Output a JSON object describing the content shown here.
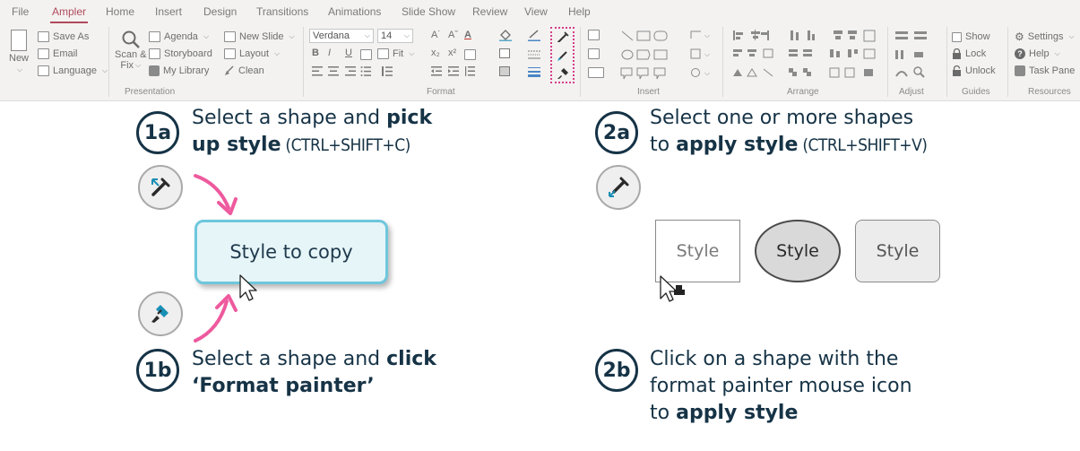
{
  "menu": [
    "File",
    "Ampler",
    "Home",
    "Insert",
    "Design",
    "Transitions",
    "Animations",
    "Slide Show",
    "Review",
    "View",
    "Help"
  ],
  "menu_active": "Ampler",
  "ribbon": {
    "new_label": "New",
    "save_as": "Save As",
    "email": "Email",
    "language": "Language",
    "scan_fix": "Scan &",
    "scan_fix_2": "Fix",
    "agenda": "Agenda",
    "storyboard": "Storyboard",
    "my_library": "My Library",
    "new_slide": "New Slide",
    "layout": "Layout",
    "clean": "Clean",
    "font_name": "Verdana",
    "font_size": "14",
    "fit": "Fit",
    "show": "Show",
    "lock": "Lock",
    "unlock": "Unlock",
    "settings": "Settings",
    "help": "Help",
    "task_pane": "Task Pane",
    "groups": {
      "presentation": "Presentation",
      "format": "Format",
      "insert": "Insert",
      "arrange": "Arrange",
      "adjust": "Adjust",
      "guides": "Guides",
      "resources": "Resources"
    }
  },
  "steps": {
    "s1a": {
      "badge": "1a",
      "line1": "Select a shape and ",
      "line1_bold": "pick",
      "line2_bold": "up style",
      "line2_shortcut": " (CTRL+SHIFT+C)"
    },
    "s1b": {
      "badge": "1b",
      "line1": "Select a shape and ",
      "line1_bold": "click",
      "line2_bold": "‘Format painter’"
    },
    "s2a": {
      "badge": "2a",
      "line1": "Select one or more shapes",
      "line2": "to ",
      "line2_bold": "apply style",
      "line2_shortcut": " (CTRL+SHIFT+V)"
    },
    "s2b": {
      "badge": "2b",
      "line1": "Click on a shape with the",
      "line2": "format painter mouse icon",
      "line3": "to ",
      "line3_bold": "apply style"
    }
  },
  "style_copy_label": "Style to copy",
  "shapes": [
    "Style",
    "Style",
    "Style"
  ],
  "colors": {
    "accent": "#b04a5a",
    "navy": "#163346",
    "pink_arrow": "#ee5a9e",
    "teal": "#6ec7dc",
    "picker_highlight": "#d63c8a"
  }
}
